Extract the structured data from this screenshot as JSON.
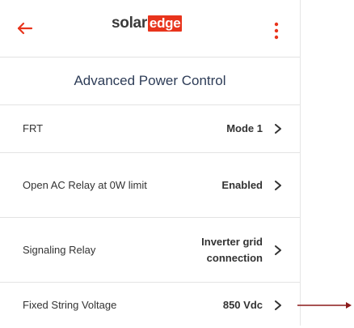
{
  "header": {
    "logo_part1": "solar",
    "logo_part2": "edge",
    "brand_red": "#e8341c",
    "back_icon": "arrow-left-icon",
    "menu_icon": "more-vertical-icon"
  },
  "page": {
    "title": "Advanced Power Control"
  },
  "settings": [
    {
      "label": "FRT",
      "value": "Mode 1"
    },
    {
      "label": "Open AC Relay at 0W limit",
      "value": "Enabled"
    },
    {
      "label": "Signaling Relay",
      "value": "Inverter grid connection"
    },
    {
      "label": "Fixed String Voltage",
      "value": "850 Vdc"
    }
  ],
  "annotation": {
    "arrow_color": "#8b1a1a"
  }
}
